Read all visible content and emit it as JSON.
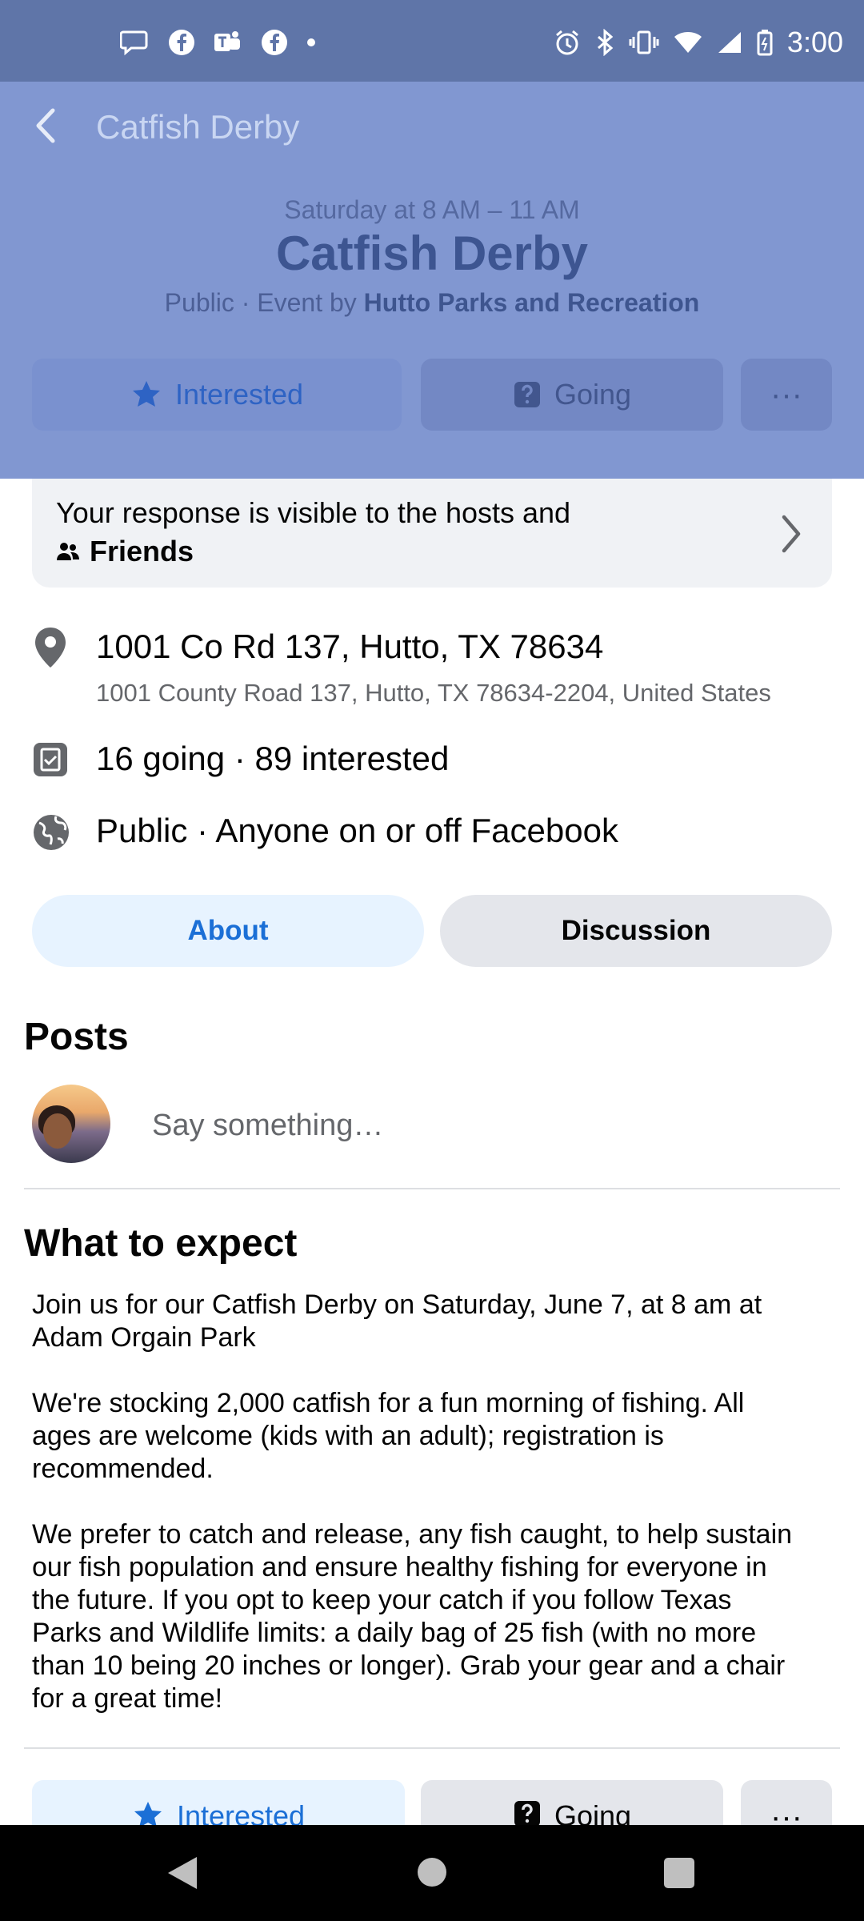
{
  "status_bar": {
    "time": "3:00",
    "left_icons": [
      "chat-bubble-icon",
      "facebook-icon",
      "teams-icon",
      "facebook-icon",
      "dot-icon"
    ],
    "right_icons": [
      "alarm-icon",
      "bluetooth-icon",
      "vibrate-icon",
      "wifi-icon",
      "signal-icon",
      "battery-icon"
    ]
  },
  "header": {
    "nav_title": "Catfish Derby",
    "date": "Saturday at 8 AM – 11 AM",
    "title": "Catfish Derby",
    "privacy_prefix": "Public · Event by ",
    "host": "Hutto Parks and Recreation",
    "interested_label": "Interested",
    "going_label": "Going",
    "more_label": "···"
  },
  "response": {
    "text": "Your response is visible to the hosts and",
    "audience": "Friends"
  },
  "details": {
    "address_main": "1001 Co Rd 137, Hutto, TX 78634",
    "address_full": "1001 County Road 137, Hutto, TX 78634-2204, United States",
    "attendance": "16 going · 89 interested",
    "visibility": "Public · Anyone on or off Facebook"
  },
  "tabs": {
    "about": "About",
    "discussion": "Discussion"
  },
  "posts": {
    "title": "Posts",
    "placeholder": "Say something…"
  },
  "expect": {
    "title": "What to expect",
    "p1_l1": "Join us for our Catfish Derby on Saturday, June 7, at 8 am at",
    "p1_l2": "Adam Orgain Park",
    "p2_l1": "We're stocking 2,000 catfish for a fun morning of fishing. All",
    "p2_l2": "ages are welcome (kids with an adult); registration is",
    "p2_l3": "recommended.",
    "p3_l1": "We prefer to catch and release, any fish caught, to help sustain",
    "p3_l2": "our fish population and ensure healthy fishing for everyone in",
    "p3_l3": "the future.  If you opt to keep your catch if you follow Texas",
    "p3_l4": "Parks and Wildlife limits: a daily bag of 25 fish (with no more",
    "p3_l5": "than 10 being 20 inches or longer). Grab your gear and a chair",
    "p3_l6": "for a great time!"
  },
  "bottom_actions": {
    "interested_label": "Interested",
    "going_label": "Going",
    "more_label": "···"
  },
  "colors": {
    "header_bg": "#8197d1",
    "status_bg": "#5f75a8",
    "accent_blue": "#1b6fd6",
    "about_tab_bg": "#e7f3ff"
  }
}
